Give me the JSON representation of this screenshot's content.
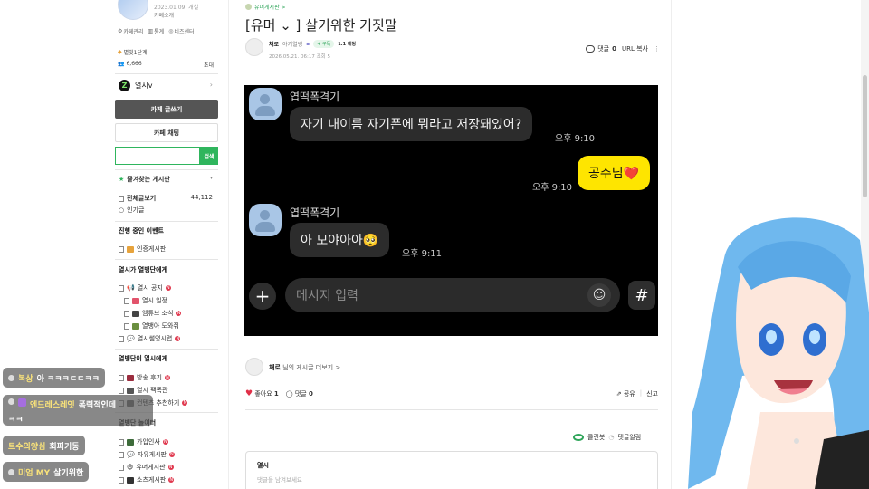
{
  "sidebar": {
    "date": "2023.01.09. 개설",
    "cafe_info": "카페소개",
    "links": [
      "카페관리",
      "통계",
      "비즈센터"
    ],
    "rank": "별빛1단계",
    "members": "6,666",
    "invite": "초대",
    "user_name": "열시v",
    "write_button": "카페 글쓰기",
    "chat_button": "카페 채팅",
    "search_button": "검색",
    "favorites_title": "즐겨찾는 게시판",
    "all_posts": "전체글보기",
    "all_posts_count": "44,112",
    "popular": "인기글",
    "event_title": "진행 중인 이벤트",
    "event_item": "인증게시판",
    "section1_title": "열시가 열뱅단에게",
    "section1_items": [
      "열시 공지",
      "열시 일정",
      "엠튜브 소식",
      "열뱅아 도와줘",
      "열시썸영시렵"
    ],
    "section2_title": "열뱅단이 열시에게",
    "section2_items": [
      "방송 후기",
      "열시 팩폭관",
      "컨텐츠 추천하기"
    ],
    "section3_title": "열뱅단 놀이터",
    "section3_items": [
      "가입인사",
      "자유게시판",
      "유머게시판",
      "소츠게시판"
    ]
  },
  "post": {
    "board": "유머게시판 >",
    "title": "[유머 ⌄ ] 살기위한 거짓말",
    "author": "채로",
    "author_rank": "아기열뱅",
    "follow": "+ 구독",
    "chat": "1:1 채팅",
    "meta": "2026.05.21. 06:17  조회 5",
    "comments_label": "댓글",
    "comments_count": "0",
    "url_copy": "URL 복사",
    "more_posts": "님의 게시글 더보기 >",
    "like_label": "좋아요",
    "like_count": "1",
    "comment_label2": "댓글",
    "comment_count2": "0",
    "share": "공유",
    "report": "신고",
    "cleanbot": "클린봇",
    "comment_sort": "댓글알림",
    "comment_box_name": "열시",
    "comment_placeholder": "댓글을 남겨보세요"
  },
  "kakao": {
    "sender": "엽떡폭격기",
    "msg1": "자기 내이름 자기폰에 뭐라고 저장돼있어?",
    "time1": "오후 9:10",
    "reply": "공주님❤️",
    "time2": "오후 9:10",
    "msg2": "아 모야아아🥺",
    "time3": "오후 9:11",
    "input_placeholder": "메시지 입력",
    "hash": "#"
  },
  "overlay_chat": [
    {
      "name": "복상",
      "text": "아 ㅋㅋㅋㄷㄷㅋㅋ"
    },
    {
      "name": "엔드레스레잇",
      "text": "폭력적인데"
    },
    {
      "name": "",
      "text": "ㅋㅋ"
    },
    {
      "name": "트수의양심",
      "text": "회피기동"
    },
    {
      "name": "미엄 MY",
      "text": "살기위한"
    }
  ],
  "colors": {
    "accent": "#2fb55d",
    "kakao_yellow": "#fee500",
    "overlay_name": "#f9e27a"
  }
}
